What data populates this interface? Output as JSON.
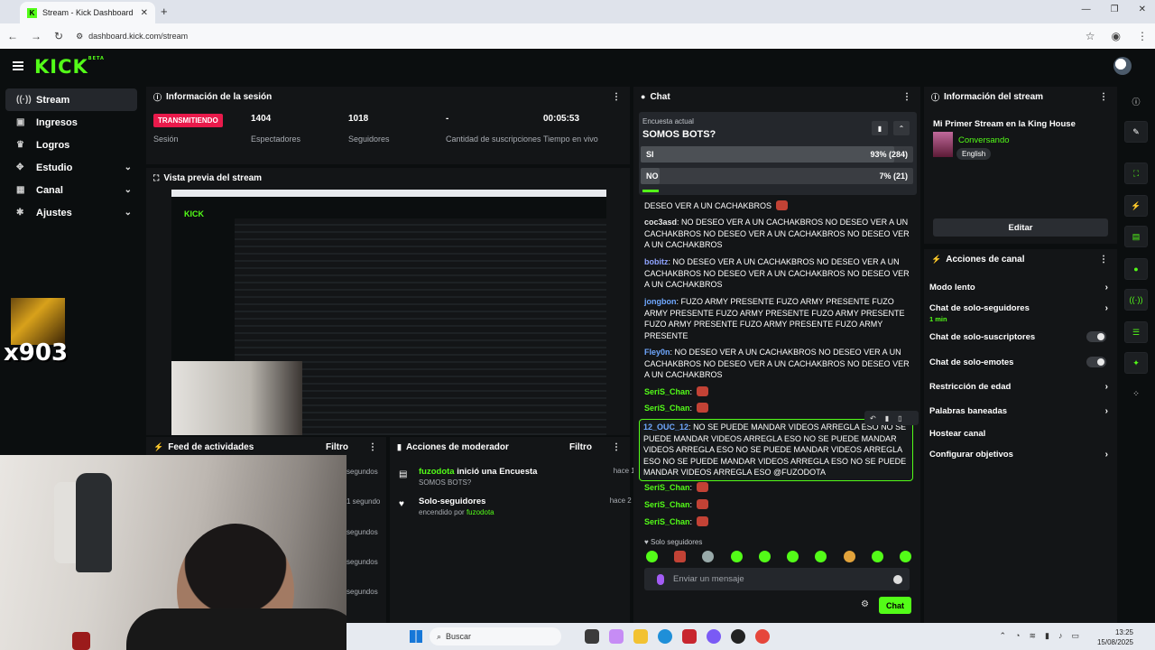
{
  "browser": {
    "tab_title": "Stream - Kick Dashboard",
    "url": "dashboard.kick.com/stream"
  },
  "app": {
    "logo": "KICK",
    "logo_sup": "BETA"
  },
  "sidebar": {
    "items": [
      {
        "label": "Stream",
        "icon": "stream-icon"
      },
      {
        "label": "Ingresos",
        "icon": "money-icon"
      },
      {
        "label": "Logros",
        "icon": "trophy-icon"
      },
      {
        "label": "Estudio",
        "icon": "studio-icon"
      },
      {
        "label": "Canal",
        "icon": "channel-icon"
      },
      {
        "label": "Ajustes",
        "icon": "gear-icon"
      }
    ],
    "streamer_tag": "x903"
  },
  "session": {
    "title": "Información de la sesión",
    "live_badge": "TRANSMITIENDO",
    "stats": [
      {
        "value": "",
        "label": "Sesión"
      },
      {
        "value": "1404",
        "label": "Espectadores"
      },
      {
        "value": "1018",
        "label": "Seguidores"
      },
      {
        "value": "-",
        "label": "Cantidad de suscripciones"
      },
      {
        "value": "00:05:53",
        "label": "Tiempo en vivo"
      }
    ]
  },
  "preview": {
    "title": "Vista previa del stream",
    "inner_logo": "KICK"
  },
  "feed": {
    "title": "Feed de actividades",
    "filter": "Filtro",
    "times": [
      "segundos",
      "1 segundo",
      "segundos",
      "segundos",
      "segundos"
    ]
  },
  "moderator": {
    "title": "Acciones de moderador",
    "filter": "Filtro",
    "rows": [
      {
        "user": "fuzodota",
        "action": " inició una Encuesta",
        "sub": "SOMOS BOTS?",
        "time": "hace 1 minuto"
      },
      {
        "user": "",
        "action": "Solo-seguidores",
        "sub_prefix": "encendido por ",
        "sub_user": "fuzodota",
        "time": "hace 2 minutos"
      }
    ]
  },
  "chat": {
    "title": "Chat",
    "poll": {
      "label": "Encuesta actual",
      "question": "SOMOS BOTS?",
      "options": [
        {
          "name": "SI",
          "result": "93% (284)",
          "percent": 93
        },
        {
          "name": "NO",
          "result": "7% (21)",
          "percent": 7
        }
      ]
    },
    "messages": [
      {
        "user": "",
        "text": "DESEO VER A UN CACHAKBROS",
        "color": "#ffffff"
      },
      {
        "user": "coc3asd",
        "text": "NO DESEO VER A UN CACHAKBROS NO DESEO VER A UN CACHAKBROS NO DESEO VER A UN CACHAKBROS NO DESEO VER A UN CACHAKBROS",
        "color": "#e8e8e8"
      },
      {
        "user": "bobitz",
        "text": "NO DESEO VER A UN CACHAKBROS NO DESEO VER A UN CACHAKBROS NO DESEO VER A UN CACHAKBROS NO DESEO VER A UN CACHAKBROS",
        "color": "#8fa3ff"
      },
      {
        "user": "jongbon",
        "text": "FUZO ARMY PRESENTE FUZO ARMY PRESENTE FUZO ARMY PRESENTE FUZO ARMY PRESENTE FUZO ARMY PRESENTE FUZO ARMY PRESENTE FUZO ARMY PRESENTE FUZO ARMY PRESENTE",
        "color": "#6fa8ff"
      },
      {
        "user": "Fley0n",
        "text": "NO DESEO VER A UN CACHAKBROS NO DESEO VER A UN CACHAKBROS NO DESEO VER A UN CACHAKBROS NO DESEO VER A UN CACHAKBROS",
        "color": "#6fa8ff"
      },
      {
        "user": "SeriS_Chan",
        "text": "",
        "color": "#53fc18"
      },
      {
        "user": "SeriS_Chan",
        "text": "",
        "color": "#53fc18"
      },
      {
        "user": "12_OUC_12",
        "text": "NO SE PUEDE MANDAR VIDEOS ARREGLA ESO NO SE PUEDE MANDAR VIDEOS ARREGLA ESO NO SE PUEDE MANDAR VIDEOS ARREGLA ESO NO SE PUEDE MANDAR VIDEOS ARREGLA ESO NO SE PUEDE MANDAR VIDEOS ARREGLA ESO NO SE PUEDE MANDAR VIDEOS ARREGLA ESO @FUZODOTA",
        "color": "#6fa8ff"
      },
      {
        "user": "SeriS_Chan",
        "text": "",
        "color": "#53fc18"
      },
      {
        "user": "SeriS_Chan",
        "text": "",
        "color": "#53fc18"
      },
      {
        "user": "SeriS_Chan",
        "text": "",
        "color": "#53fc18"
      }
    ],
    "follower_mode": "Solo seguidores",
    "input_placeholder": "Enviar un mensaje",
    "send_label": "Chat"
  },
  "stream_info": {
    "title": "Información del stream",
    "stream_title": "Mi Primer Stream en la King House",
    "category": "Conversando",
    "language": "English",
    "edit_label": "Editar"
  },
  "channel_actions": {
    "title": "Acciones de canal",
    "items": [
      {
        "label": "Modo lento",
        "control": "chevron"
      },
      {
        "label": "Chat de solo-seguidores",
        "sub": "1 min",
        "control": "chevron"
      },
      {
        "label": "Chat de solo-suscriptores",
        "control": "toggle"
      },
      {
        "label": "Chat de solo-emotes",
        "control": "toggle"
      },
      {
        "label": "Restricción de edad",
        "control": "chevron"
      },
      {
        "label": "Palabras baneadas",
        "control": "chevron"
      },
      {
        "label": "Hostear canal",
        "control": "none"
      },
      {
        "label": "Configurar objetivos",
        "control": "chevron"
      }
    ]
  },
  "taskbar": {
    "search_placeholder": "Buscar",
    "time": "13:25",
    "date": "15/08/2025"
  },
  "colors": {
    "accent": "#53fc18",
    "live": "#e91a4b",
    "panel": "#131517",
    "background": "#0b0e0f"
  }
}
